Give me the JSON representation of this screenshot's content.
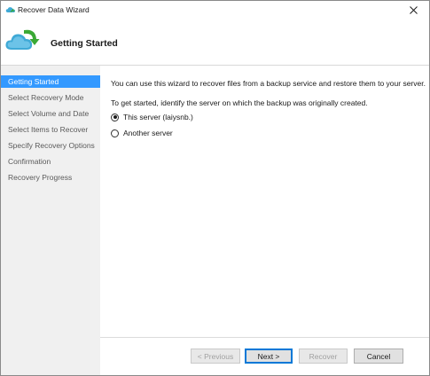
{
  "window": {
    "title": "Recover Data Wizard",
    "close_glyph": "✕"
  },
  "header": {
    "title": "Getting Started",
    "icon": "cloud-restore-icon"
  },
  "steps": [
    {
      "label": "Getting Started",
      "active": true
    },
    {
      "label": "Select Recovery Mode",
      "active": false
    },
    {
      "label": "Select Volume and Date",
      "active": false
    },
    {
      "label": "Select Items to Recover",
      "active": false
    },
    {
      "label": "Specify Recovery Options",
      "active": false
    },
    {
      "label": "Confirmation",
      "active": false
    },
    {
      "label": "Recovery Progress",
      "active": false
    }
  ],
  "content": {
    "description": "You can use this wizard to recover files from a backup service and restore them to your server.",
    "prompt": "To get started, identify the server on which the backup was originally created.",
    "options": [
      {
        "label": "This server (laiysnb.)",
        "checked": true
      },
      {
        "label": "Another server",
        "checked": false
      }
    ]
  },
  "buttons": {
    "previous": "< Previous",
    "next": "Next >",
    "recover": "Recover",
    "cancel": "Cancel"
  },
  "colors": {
    "active_step_bg": "#3399ff",
    "sidebar_bg": "#f0f0f0",
    "default_button_border": "#0078d7",
    "cloud_blue": "#3fa9d6",
    "arrow_green": "#3aa935"
  }
}
